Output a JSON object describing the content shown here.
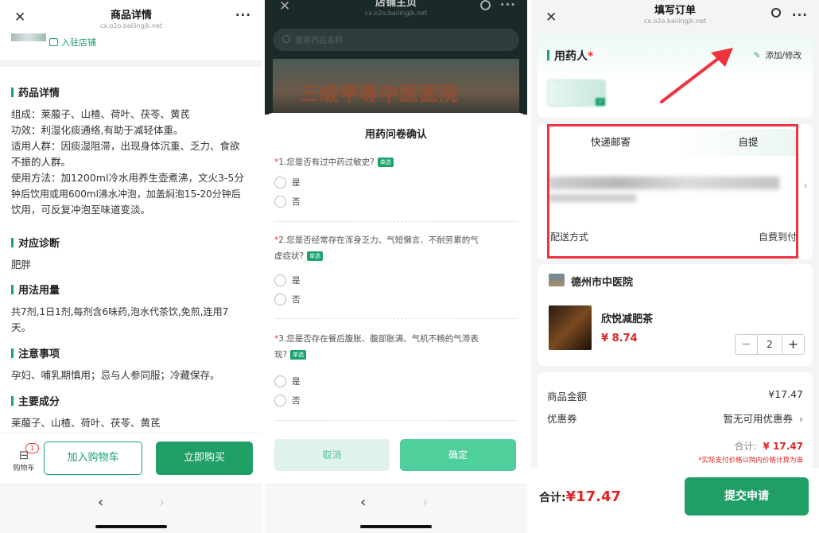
{
  "p1": {
    "title": "商品详情",
    "url": "cx.o2o.bailingjk.net",
    "enter_store": "入驻店铺",
    "sections": [
      {
        "title": "药品详情",
        "lines": [
          "组成：莱菔子、山楂、荷叶、茯苓、黄芪",
          "功效：利湿化痰通络,有助于减轻体重。",
          "适用人群：因痰湿阻滞，出现身体沉重、乏力、食欲",
          "不振的人群。",
          "使用方法：加1200ml冷水用养生壶煮沸，文火3-5分",
          "钟后饮用或用600ml沸水冲泡，加盖焖泡15-20分钟后",
          "饮用，可反复冲泡至味道变淡。"
        ]
      },
      {
        "title": "对应诊断",
        "lines": [
          "肥胖"
        ]
      },
      {
        "title": "用法用量",
        "lines": [
          "共7剂,1日1剂,每剂含6味药,泡水代茶饮,免煎,连用7",
          "天。"
        ]
      },
      {
        "title": "注意事项",
        "lines": [
          "孕妇、哺乳期慎用；忌与人参同服；冷藏保存。"
        ]
      },
      {
        "title": "主要成分",
        "lines": [
          "莱菔子、山楂、荷叶、茯苓、黄芪"
        ]
      }
    ],
    "cart_badge": "1",
    "cart_label": "购物车",
    "add_cart": "加入购物车",
    "buy_now": "立即购买",
    "nav_back": "‹",
    "nav_forward": "›"
  },
  "p2": {
    "title": "店铺主页",
    "url": "cx.o2o.bailingjk.net",
    "search_placeholder": "搜索药品名称",
    "banner_text": "三级甲等中医医院",
    "modal_title": "用药问卷确认",
    "questions": [
      {
        "star": "*",
        "text": "1.您是否有过中药过敏史?",
        "text2": "",
        "tag": "单选",
        "yes": "是",
        "no": "否"
      },
      {
        "star": "*",
        "text": "2.您是否经常存在浑身乏力、气短懒言、不耐劳累的气",
        "text2": "虚症状?",
        "tag": "单选",
        "yes": "是",
        "no": "否"
      },
      {
        "star": "*",
        "text": "3.您是否存在餐后腹胀、腹部胀满、气机不畅的气滞表",
        "text2": "现?",
        "tag": "单选",
        "yes": "是",
        "no": "否"
      }
    ],
    "cancel": "取消",
    "confirm": "确定",
    "nav_back": "‹",
    "nav_forward": "›"
  },
  "p3": {
    "title": "填写订单",
    "url": "cx.o2o.bailingjk.net",
    "patient_label": "用药人",
    "required_mark": "*",
    "add_edit": "添加/修改",
    "tab_express": "快递邮寄",
    "tab_pickup": "自提",
    "delivery_label": "配送方式",
    "delivery_value": "自费到付",
    "hospital": "德州市中医院",
    "product_name": "欣悦减肥茶",
    "product_price": "¥ 8.74",
    "qty": "2",
    "minus": "—",
    "plus": "+",
    "goods_amount_label": "商品金额",
    "goods_amount": "¥17.47",
    "coupon_label": "优惠券",
    "coupon_value": "暂无可用优惠券",
    "subtotal_label": "合计:",
    "subtotal": "¥ 17.47",
    "note": "*实际支付价格以院内价格计算为准",
    "total_label": "合计:",
    "total": "¥17.47",
    "submit": "提交申请"
  },
  "colors": {
    "brand": "#1aa36b",
    "price": "#e02424",
    "annotation": "#ee3340"
  }
}
